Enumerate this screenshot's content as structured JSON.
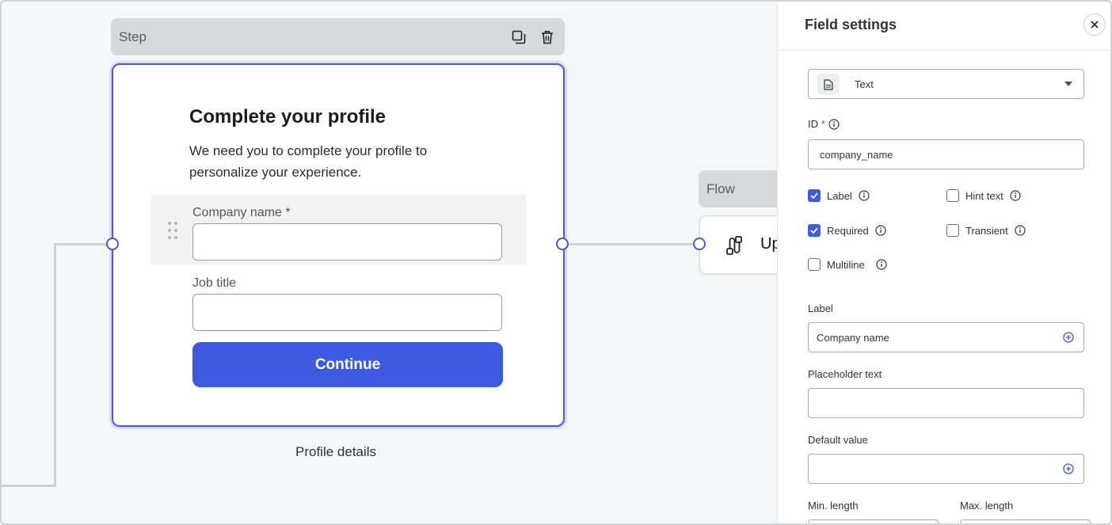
{
  "canvas": {
    "step": {
      "header_title": "Step",
      "card_title": "Complete your profile",
      "card_description": "We need you to complete your profile to personalize your experience.",
      "fields": [
        {
          "label": "Company name *",
          "value": ""
        },
        {
          "label": "Job title",
          "value": ""
        }
      ],
      "continue_label": "Continue",
      "caption": "Profile details"
    },
    "flow": {
      "header_title": "Flow",
      "card_text": "Up"
    }
  },
  "panel": {
    "title": "Field settings",
    "field_type": {
      "value": "Text",
      "icon": "document-icon"
    },
    "id": {
      "label": "ID",
      "required_mark": "*",
      "value": "company_name"
    },
    "options": [
      {
        "label": "Label",
        "checked": true
      },
      {
        "label": "Hint text",
        "checked": false
      },
      {
        "label": "Required",
        "checked": true
      },
      {
        "label": "Transient",
        "checked": false
      },
      {
        "label": "Multiline",
        "checked": false
      }
    ],
    "label_field": {
      "label": "Label",
      "value": "Company name"
    },
    "placeholder_field": {
      "label": "Placeholder text",
      "value": ""
    },
    "default_field": {
      "label": "Default value",
      "value": ""
    },
    "min_length": {
      "label": "Min. length"
    },
    "max_length": {
      "label": "Max. length"
    }
  },
  "colors": {
    "accent": "#3d5ae0",
    "node_border": "#4a5bd4",
    "required": "#d63d3d"
  }
}
